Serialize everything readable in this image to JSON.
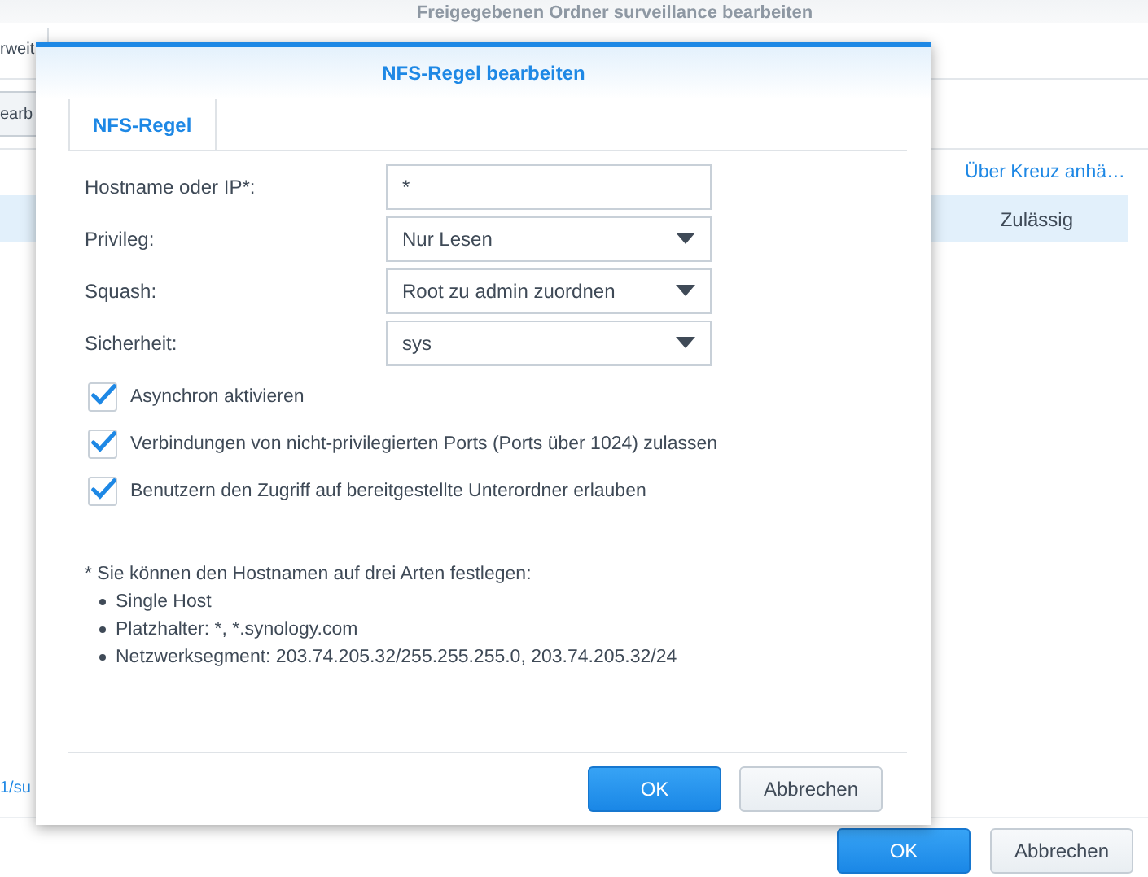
{
  "background_window": {
    "title": "Freigegebenen Ordner surveillance bearbeiten",
    "tab_fragment": "rweit",
    "toolbar_fragment": "earb",
    "column_header": "Über Kreuz anhä…",
    "row_cell": "Zulässig",
    "row_selected": true,
    "link_fragment": "1/su",
    "buttons": [
      {
        "label": "OK",
        "kind": "primary"
      },
      {
        "label": "Abbrechen",
        "kind": "secondary"
      }
    ]
  },
  "dialog": {
    "title": "NFS-Regel bearbeiten",
    "tabs": [
      {
        "label": "NFS-Regel",
        "selected": true
      }
    ],
    "fields": [
      {
        "label": "Hostname oder IP*:",
        "kind": "text",
        "value": "*"
      },
      {
        "label": "Privileg:",
        "kind": "select",
        "value": "Nur Lesen"
      },
      {
        "label": "Squash:",
        "kind": "select",
        "value": "Root zu admin zuordnen"
      },
      {
        "label": "Sicherheit:",
        "kind": "select",
        "value": "sys"
      }
    ],
    "checkboxes": [
      {
        "label": "Asynchron aktivieren",
        "checked": true
      },
      {
        "label": "Verbindungen von nicht-privilegierten Ports (Ports über 1024) zulassen",
        "checked": true
      },
      {
        "label": "Benutzern den Zugriff auf bereitgestellte Unterordner erlauben",
        "checked": true
      }
    ],
    "note": "* Sie können den Hostnamen auf drei Arten festlegen:",
    "bullets": [
      "Single Host",
      "Platzhalter: *, *.synology.com",
      "Netzwerksegment: 203.74.205.32/255.255.255.0, 203.74.205.32/24"
    ],
    "buttons": [
      {
        "label": "OK",
        "kind": "primary"
      },
      {
        "label": "Abbrechen",
        "kind": "secondary"
      }
    ]
  }
}
